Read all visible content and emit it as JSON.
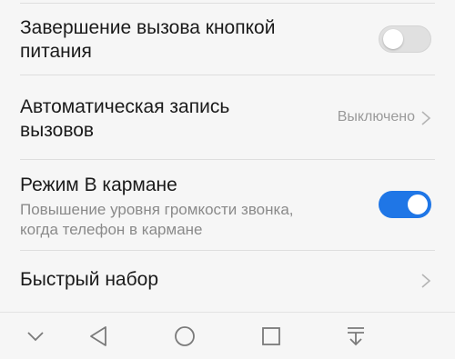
{
  "settings": {
    "end_call_power": {
      "title_line1": "Завершение вызова кнопкой",
      "title_line2": "питания",
      "enabled": false
    },
    "auto_record": {
      "title_line1": "Автоматическая запись",
      "title_line2": "вызовов",
      "value": "Выключено"
    },
    "pocket_mode": {
      "title": "Режим В кармане",
      "subtitle_line1": "Повышение уровня громкости звонка,",
      "subtitle_line2": "когда телефон в кармане",
      "enabled": true
    },
    "speed_dial": {
      "title": "Быстрый набор"
    }
  },
  "colors": {
    "accent": "#1f76e6",
    "text_primary": "#1a1a1a",
    "text_secondary": "#8a8a8a",
    "background": "#f6f6f6"
  },
  "navbar": {
    "icons": [
      "chevron-down-icon",
      "back-icon",
      "home-icon",
      "recents-icon",
      "notification-pull-icon"
    ]
  }
}
